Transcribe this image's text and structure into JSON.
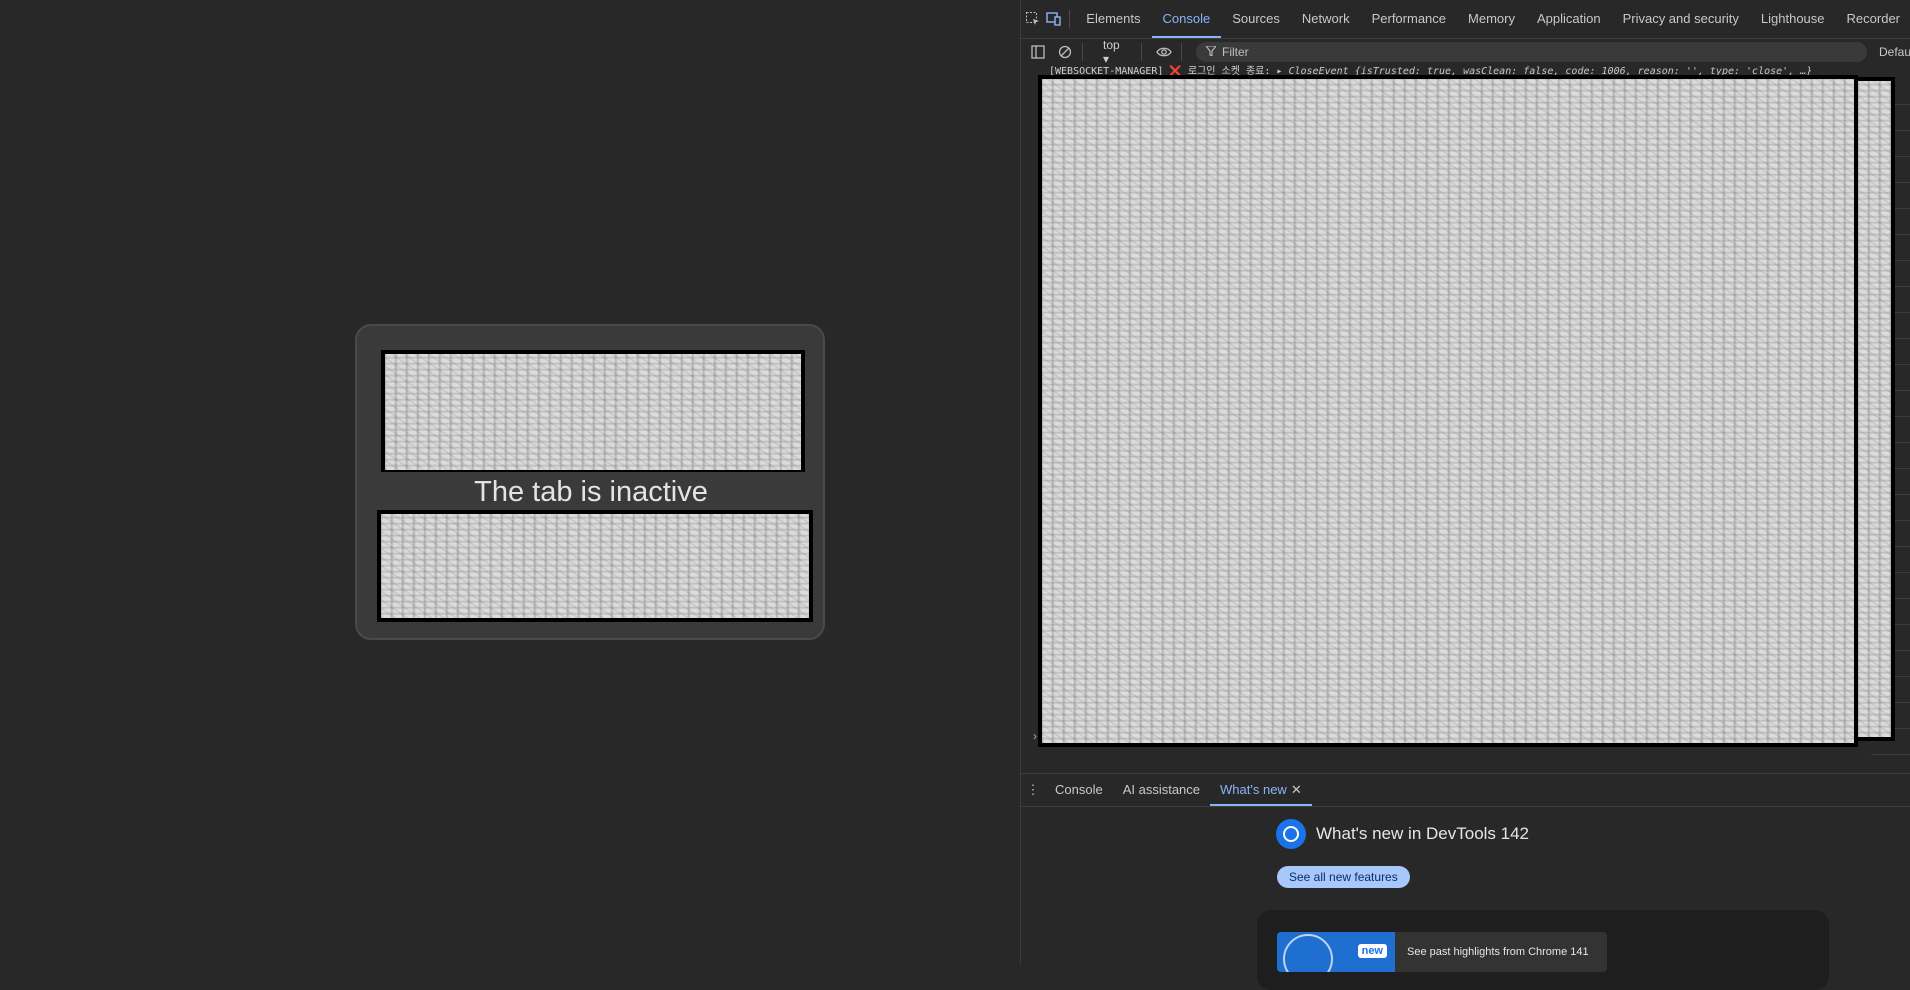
{
  "page": {
    "inactive_message": "The tab is inactive"
  },
  "devtools": {
    "tabs": [
      {
        "label": "Elements"
      },
      {
        "label": "Console"
      },
      {
        "label": "Sources"
      },
      {
        "label": "Network"
      },
      {
        "label": "Performance"
      },
      {
        "label": "Memory"
      },
      {
        "label": "Application"
      },
      {
        "label": "Privacy and security"
      },
      {
        "label": "Lighthouse"
      },
      {
        "label": "Recorder"
      }
    ],
    "active_tab": "Console",
    "toolbar": {
      "context": "top",
      "filter_placeholder": "Filter",
      "levels": "Defau"
    },
    "console": {
      "line_prefix": "[WEBSOCKET-MANAGER]",
      "line_message": "로그인 소켓 종료:",
      "line_object": "CloseEvent {isTrusted: true, wasClean: false, code: 1006, reason: '', type: 'close', …}"
    },
    "drawer": {
      "tabs": [
        {
          "label": "Console"
        },
        {
          "label": "AI assistance"
        },
        {
          "label": "What's new"
        }
      ],
      "active_tab": "What's new"
    },
    "whats_new": {
      "title": "What's new in DevTools 142",
      "see_all_button": "See all new features",
      "badge": "new",
      "highlight_text": "See past highlights from Chrome 141"
    }
  }
}
